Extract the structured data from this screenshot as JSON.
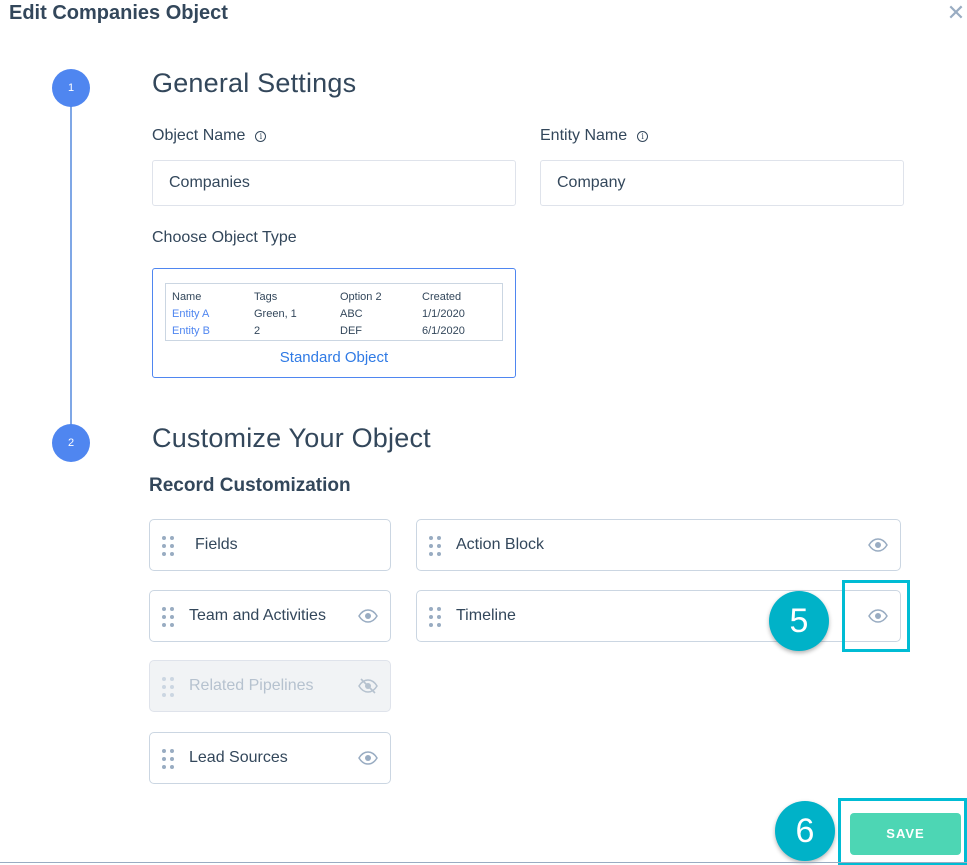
{
  "modal": {
    "title": "Edit Companies Object",
    "close_glyph": "✕"
  },
  "steps": [
    {
      "number": "1",
      "title": "General Settings"
    },
    {
      "number": "2",
      "title": "Customize Your Object"
    }
  ],
  "general": {
    "object_name_label": "Object Name",
    "object_name_value": "Companies",
    "entity_name_label": "Entity Name",
    "entity_name_value": "Company",
    "info_glyph": "i",
    "choose_type_label": "Choose Object Type"
  },
  "object_type": {
    "label": "Standard Object",
    "preview_headers": [
      "Name",
      "Tags",
      "Option 2",
      "Created"
    ],
    "preview_rows": [
      [
        "Entity A",
        "Green, 1",
        "ABC",
        "1/1/2020"
      ],
      [
        "Entity B",
        "2",
        "DEF",
        "6/1/2020"
      ]
    ]
  },
  "record_customization": {
    "title": "Record Customization",
    "cards": [
      {
        "label": "Fields",
        "eye": "none",
        "enabled": true
      },
      {
        "label": "Action Block",
        "eye": "visible",
        "enabled": true
      },
      {
        "label": "Team and Activities",
        "eye": "visible",
        "enabled": true
      },
      {
        "label": "Timeline",
        "eye": "visible",
        "enabled": true
      },
      {
        "label": "Related Pipelines",
        "eye": "hidden",
        "enabled": false
      },
      {
        "label": "Lead Sources",
        "eye": "visible",
        "enabled": true
      }
    ]
  },
  "annotations": {
    "badge_5": "5",
    "badge_6": "6"
  },
  "footer": {
    "save_label": "SAVE"
  },
  "colors": {
    "accent_blue": "#4f86f0",
    "teal_highlight": "#00bcd4",
    "save_green": "#4dd6b4",
    "text": "#33475b"
  }
}
